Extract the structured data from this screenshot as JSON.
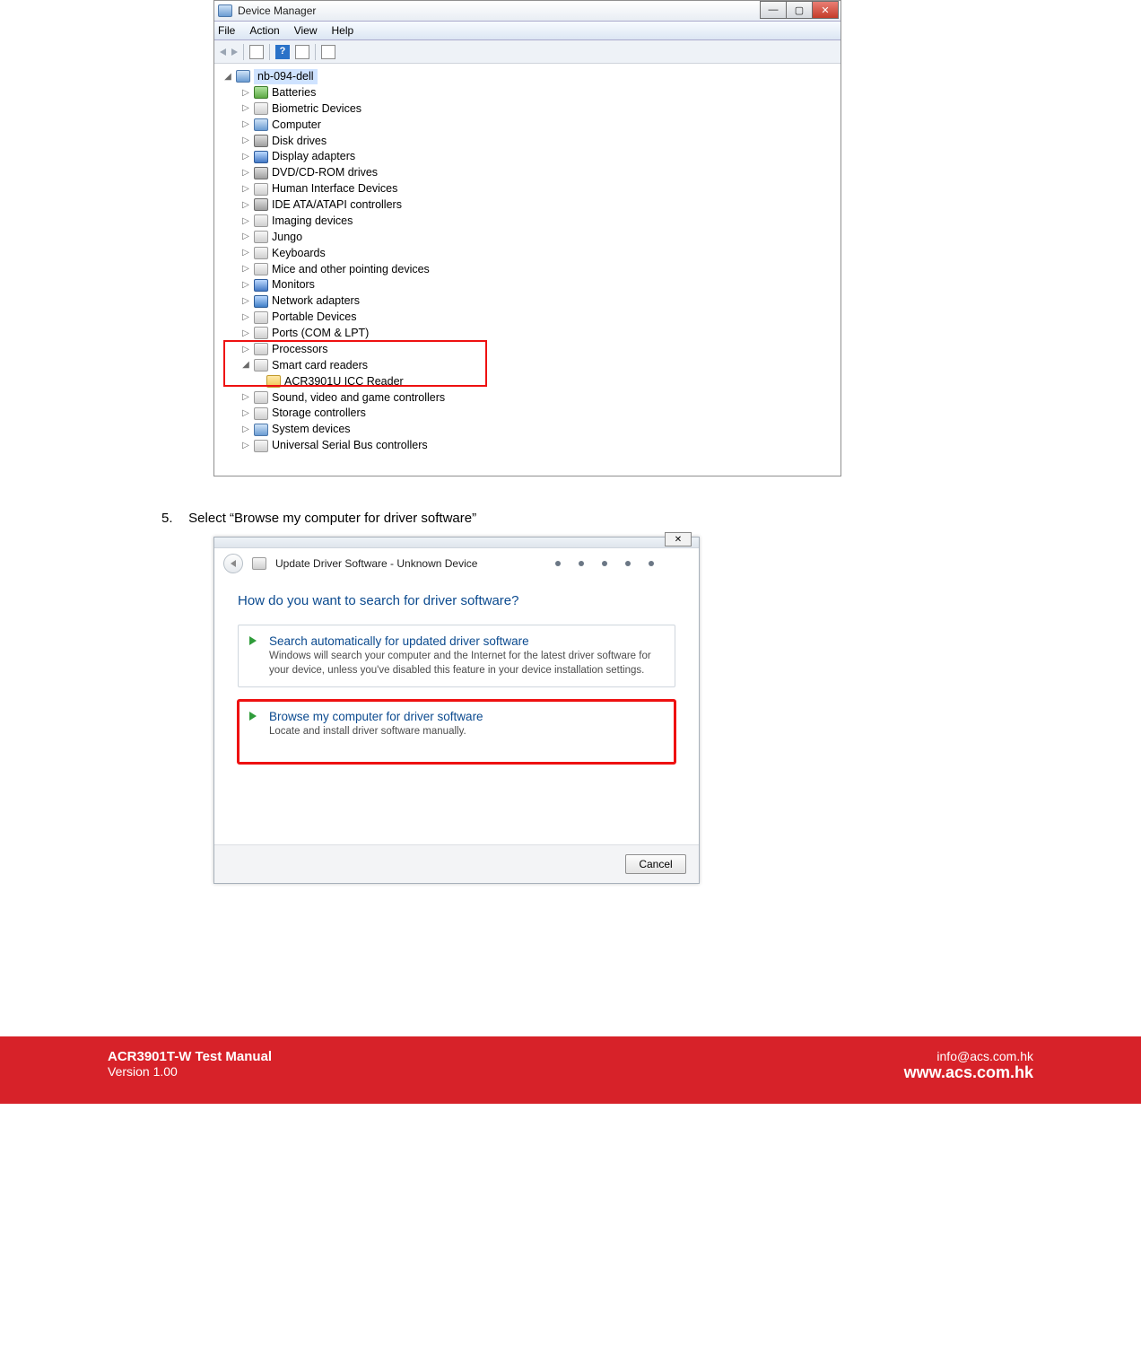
{
  "devmgr": {
    "title": "Device Manager",
    "menus": [
      "File",
      "Action",
      "View",
      "Help"
    ],
    "root": "nb-094-dell",
    "nodes": [
      {
        "label": "Batteries",
        "icon": "battery"
      },
      {
        "label": "Biometric Devices",
        "icon": "generic"
      },
      {
        "label": "Computer",
        "icon": "computer"
      },
      {
        "label": "Disk drives",
        "icon": "disk"
      },
      {
        "label": "Display adapters",
        "icon": "display"
      },
      {
        "label": "DVD/CD-ROM drives",
        "icon": "disk"
      },
      {
        "label": "Human Interface Devices",
        "icon": "generic"
      },
      {
        "label": "IDE ATA/ATAPI controllers",
        "icon": "disk"
      },
      {
        "label": "Imaging devices",
        "icon": "generic"
      },
      {
        "label": "Jungo",
        "icon": "generic"
      },
      {
        "label": "Keyboards",
        "icon": "generic"
      },
      {
        "label": "Mice and other pointing devices",
        "icon": "generic"
      },
      {
        "label": "Monitors",
        "icon": "display"
      },
      {
        "label": "Network adapters",
        "icon": "network"
      },
      {
        "label": "Portable Devices",
        "icon": "generic"
      },
      {
        "label": "Ports (COM & LPT)",
        "icon": "generic"
      }
    ],
    "highlighted": {
      "processors": "Processors",
      "smartcard": "Smart card readers",
      "reader": "ACR3901U ICC Reader"
    },
    "nodes_after": [
      {
        "label": "Sound, video and game controllers",
        "icon": "generic"
      },
      {
        "label": "Storage controllers",
        "icon": "generic"
      },
      {
        "label": "System devices",
        "icon": "computer"
      },
      {
        "label": "Universal Serial Bus controllers",
        "icon": "generic"
      }
    ]
  },
  "step": {
    "num": "5.",
    "text": "Select “Browse my computer for driver software”"
  },
  "upd": {
    "title": "Update Driver Software - Unknown Device",
    "question": "How do you want to search for driver software?",
    "opt1_title": "Search automatically for updated driver software",
    "opt1_desc": "Windows will search your computer and the Internet for the latest driver software for your device, unless you've disabled this feature in your device installation settings.",
    "opt2_title": "Browse my computer for driver software",
    "opt2_desc": "Locate and install driver software manually.",
    "cancel": "Cancel",
    "close_glyph": "✕"
  },
  "footer": {
    "product": "ACR3901T-W Test Manual",
    "version": "Version 1.00",
    "email": "info@acs.com.hk",
    "site": "www.acs.com.hk"
  }
}
